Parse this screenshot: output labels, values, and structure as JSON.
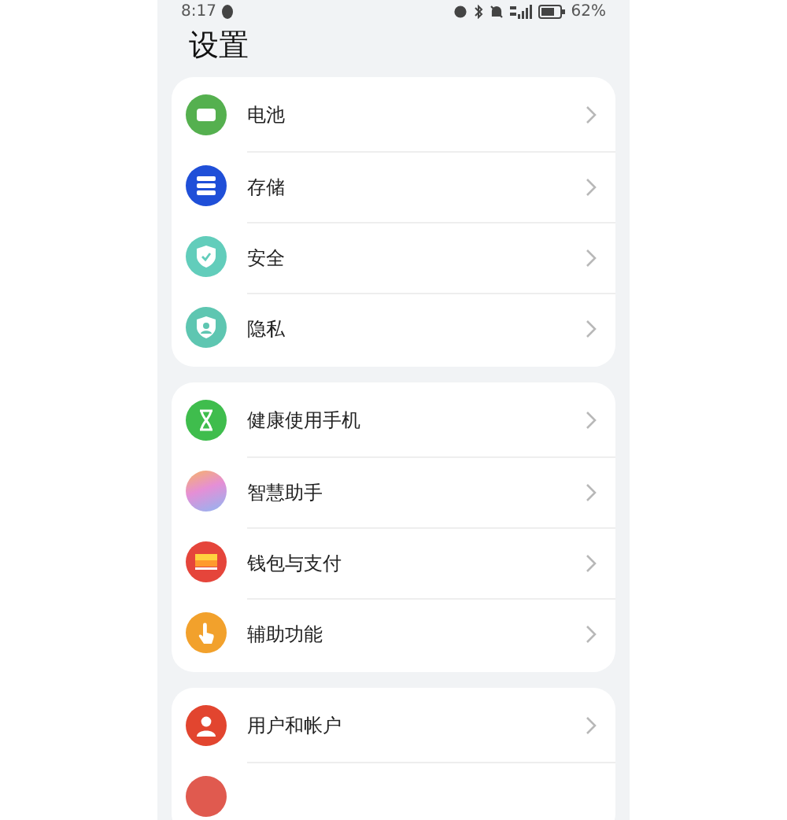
{
  "status_bar": {
    "time": "8:17",
    "battery": "62%"
  },
  "title": "设置",
  "groups": [
    {
      "items": [
        {
          "kind": "battery",
          "label": "电池"
        },
        {
          "kind": "storage",
          "label": "存储"
        },
        {
          "kind": "security",
          "label": "安全"
        },
        {
          "kind": "privacy",
          "label": "隐私"
        }
      ]
    },
    {
      "items": [
        {
          "kind": "hourglass",
          "label": "健康使用手机"
        },
        {
          "kind": "assistant",
          "label": "智慧助手"
        },
        {
          "kind": "wallet",
          "label": "钱包与支付"
        },
        {
          "kind": "accessibility",
          "label": "辅助功能"
        }
      ]
    },
    {
      "items": [
        {
          "kind": "user",
          "label": "用户和帐户"
        },
        {
          "kind": "cut"
        }
      ]
    }
  ]
}
